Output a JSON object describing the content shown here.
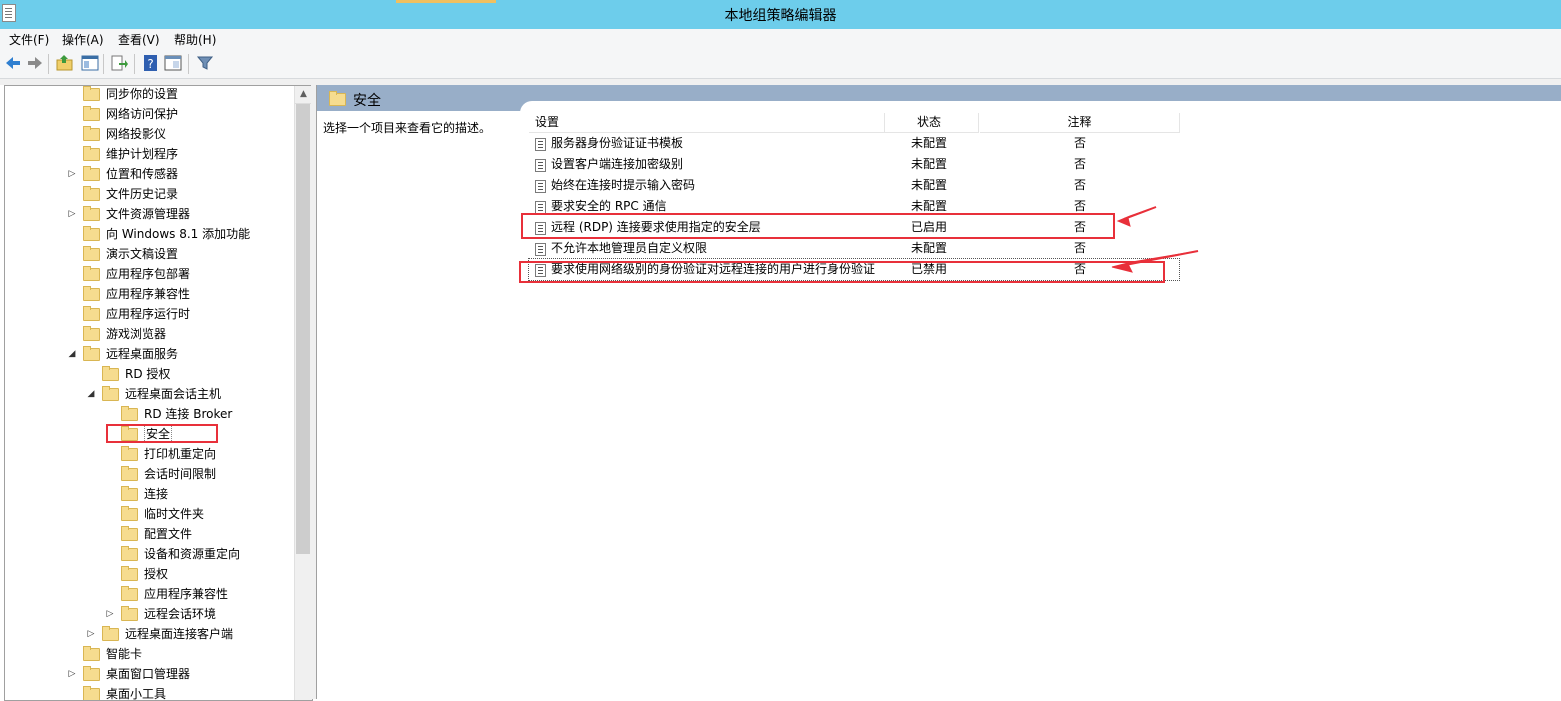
{
  "window": {
    "title": "本地组策略编辑器"
  },
  "menu": [
    {
      "label": "文件(F)"
    },
    {
      "label": "操作(A)"
    },
    {
      "label": "查看(V)"
    },
    {
      "label": "帮助(H)"
    }
  ],
  "toolbar": {
    "icons": [
      "back-arrow-icon",
      "forward-arrow-icon",
      "up-folder-icon",
      "show-hide-tree-icon",
      "export-list-icon",
      "help-icon",
      "properties-icon",
      "filter-icon"
    ]
  },
  "tree": {
    "items": [
      {
        "label": "同步你的设置",
        "indent": 0,
        "expander": ""
      },
      {
        "label": "网络访问保护",
        "indent": 0,
        "expander": ""
      },
      {
        "label": "网络投影仪",
        "indent": 0,
        "expander": ""
      },
      {
        "label": "维护计划程序",
        "indent": 0,
        "expander": ""
      },
      {
        "label": "位置和传感器",
        "indent": 0,
        "expander": "▷"
      },
      {
        "label": "文件历史记录",
        "indent": 0,
        "expander": ""
      },
      {
        "label": "文件资源管理器",
        "indent": 0,
        "expander": "▷"
      },
      {
        "label": "向 Windows 8.1 添加功能",
        "indent": 0,
        "expander": ""
      },
      {
        "label": "演示文稿设置",
        "indent": 0,
        "expander": ""
      },
      {
        "label": "应用程序包部署",
        "indent": 0,
        "expander": ""
      },
      {
        "label": "应用程序兼容性",
        "indent": 0,
        "expander": ""
      },
      {
        "label": "应用程序运行时",
        "indent": 0,
        "expander": ""
      },
      {
        "label": "游戏浏览器",
        "indent": 0,
        "expander": ""
      },
      {
        "label": "远程桌面服务",
        "indent": 0,
        "expander": "◢"
      },
      {
        "label": "RD 授权",
        "indent": 1,
        "expander": ""
      },
      {
        "label": "远程桌面会话主机",
        "indent": 1,
        "expander": "◢"
      },
      {
        "label": "RD 连接 Broker",
        "indent": 2,
        "expander": ""
      },
      {
        "label": "安全",
        "indent": 2,
        "expander": "",
        "selected": true
      },
      {
        "label": "打印机重定向",
        "indent": 2,
        "expander": ""
      },
      {
        "label": "会话时间限制",
        "indent": 2,
        "expander": ""
      },
      {
        "label": "连接",
        "indent": 2,
        "expander": ""
      },
      {
        "label": "临时文件夹",
        "indent": 2,
        "expander": ""
      },
      {
        "label": "配置文件",
        "indent": 2,
        "expander": ""
      },
      {
        "label": "设备和资源重定向",
        "indent": 2,
        "expander": ""
      },
      {
        "label": "授权",
        "indent": 2,
        "expander": ""
      },
      {
        "label": "应用程序兼容性",
        "indent": 2,
        "expander": ""
      },
      {
        "label": "远程会话环境",
        "indent": 2,
        "expander": "▷"
      },
      {
        "label": "远程桌面连接客户端",
        "indent": 1,
        "expander": "▷"
      },
      {
        "label": "智能卡",
        "indent": 0,
        "expander": ""
      },
      {
        "label": "桌面窗口管理器",
        "indent": 0,
        "expander": "▷"
      },
      {
        "label": "桌面小工具",
        "indent": 0,
        "expander": ""
      }
    ]
  },
  "details": {
    "section_title": "安全",
    "description": "选择一个项目来查看它的描述。",
    "columns": {
      "setting": "设置",
      "state": "状态",
      "comment": "注释"
    },
    "rows": [
      {
        "name": "服务器身份验证证书模板",
        "state": "未配置",
        "comment": "否"
      },
      {
        "name": "设置客户端连接加密级别",
        "state": "未配置",
        "comment": "否"
      },
      {
        "name": "始终在连接时提示输入密码",
        "state": "未配置",
        "comment": "否"
      },
      {
        "name": "要求安全的 RPC 通信",
        "state": "未配置",
        "comment": "否"
      },
      {
        "name": "远程 (RDP) 连接要求使用指定的安全层",
        "state": "已启用",
        "comment": "否"
      },
      {
        "name": "不允许本地管理员自定义权限",
        "state": "未配置",
        "comment": "否"
      },
      {
        "name": "要求使用网络级别的身份验证对远程连接的用户进行身份验证",
        "state": "已禁用",
        "comment": "否"
      }
    ]
  },
  "annotation": {
    "color": "#e8303a"
  }
}
